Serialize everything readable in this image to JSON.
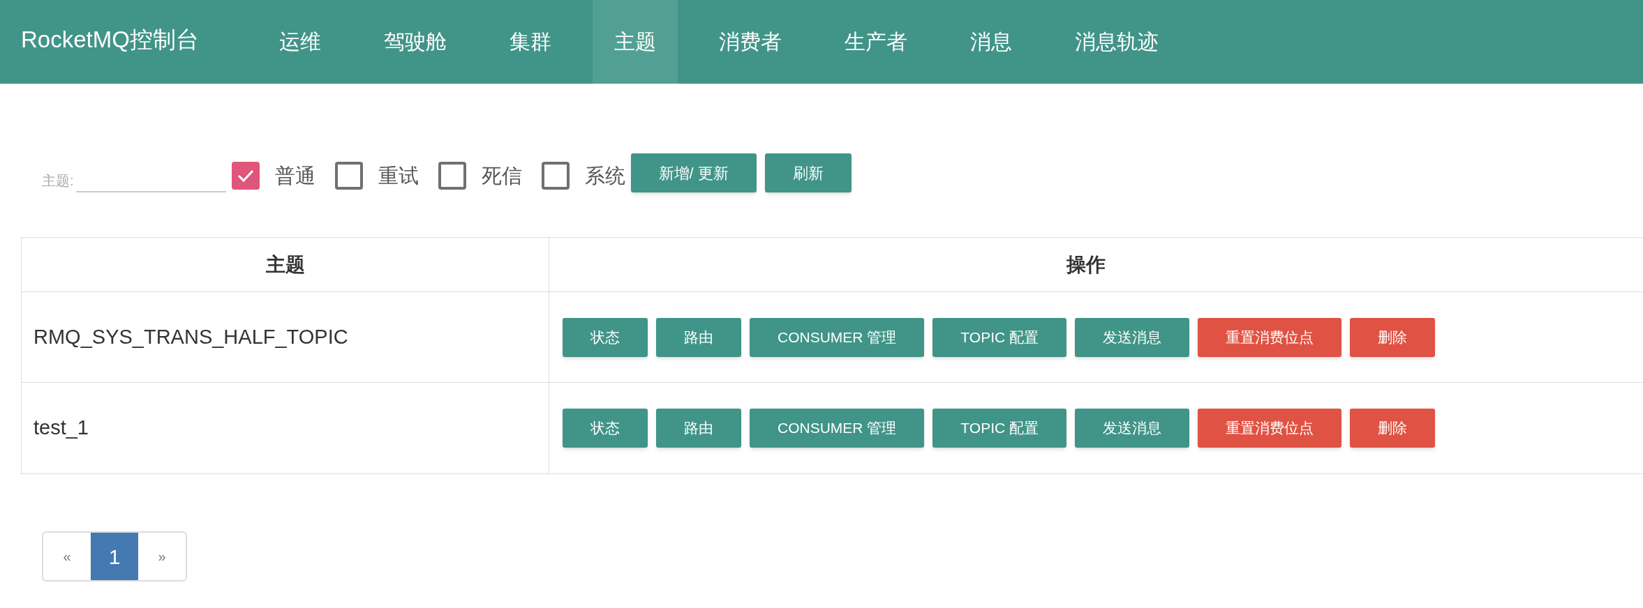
{
  "navbar": {
    "brand": "RocketMQ控制台",
    "items": [
      {
        "label": "运维",
        "selected": false
      },
      {
        "label": "驾驶舱",
        "selected": false
      },
      {
        "label": "集群",
        "selected": false
      },
      {
        "label": "主题",
        "selected": true
      },
      {
        "label": "消费者",
        "selected": false
      },
      {
        "label": "生产者",
        "selected": false
      },
      {
        "label": "消息",
        "selected": false
      },
      {
        "label": "消息轨迹",
        "selected": false
      }
    ]
  },
  "filter": {
    "label": "主题:",
    "checkboxes": [
      {
        "label": "普通",
        "checked": true
      },
      {
        "label": "重试",
        "checked": false
      },
      {
        "label": "死信",
        "checked": false
      },
      {
        "label": "系统",
        "checked": false
      }
    ],
    "buttons": [
      "新增/ 更新",
      "刷新"
    ]
  },
  "table": {
    "columns": [
      "主题",
      "操作"
    ],
    "rows": [
      {
        "topic": "RMQ_SYS_TRANS_HALF_TOPIC",
        "actions": [
          {
            "label": "状态",
            "kind": "normal"
          },
          {
            "label": "路由",
            "kind": "normal"
          },
          {
            "label": "CONSUMER 管理",
            "kind": "normal"
          },
          {
            "label": "TOPIC 配置",
            "kind": "normal"
          },
          {
            "label": "发送消息",
            "kind": "normal"
          },
          {
            "label": "重置消费位点",
            "kind": "danger"
          },
          {
            "label": "删除",
            "kind": "danger"
          }
        ]
      },
      {
        "topic": "test_1",
        "actions": [
          {
            "label": "状态",
            "kind": "normal"
          },
          {
            "label": "路由",
            "kind": "normal"
          },
          {
            "label": "CONSUMER 管理",
            "kind": "normal"
          },
          {
            "label": "TOPIC 配置",
            "kind": "normal"
          },
          {
            "label": "发送消息",
            "kind": "normal"
          },
          {
            "label": "重置消费位点",
            "kind": "danger"
          },
          {
            "label": "删除",
            "kind": "danger"
          }
        ]
      }
    ]
  },
  "pagination": [
    {
      "label": "«",
      "selected": false
    },
    {
      "label": "1",
      "selected": true
    },
    {
      "label": "»",
      "selected": false
    }
  ]
}
